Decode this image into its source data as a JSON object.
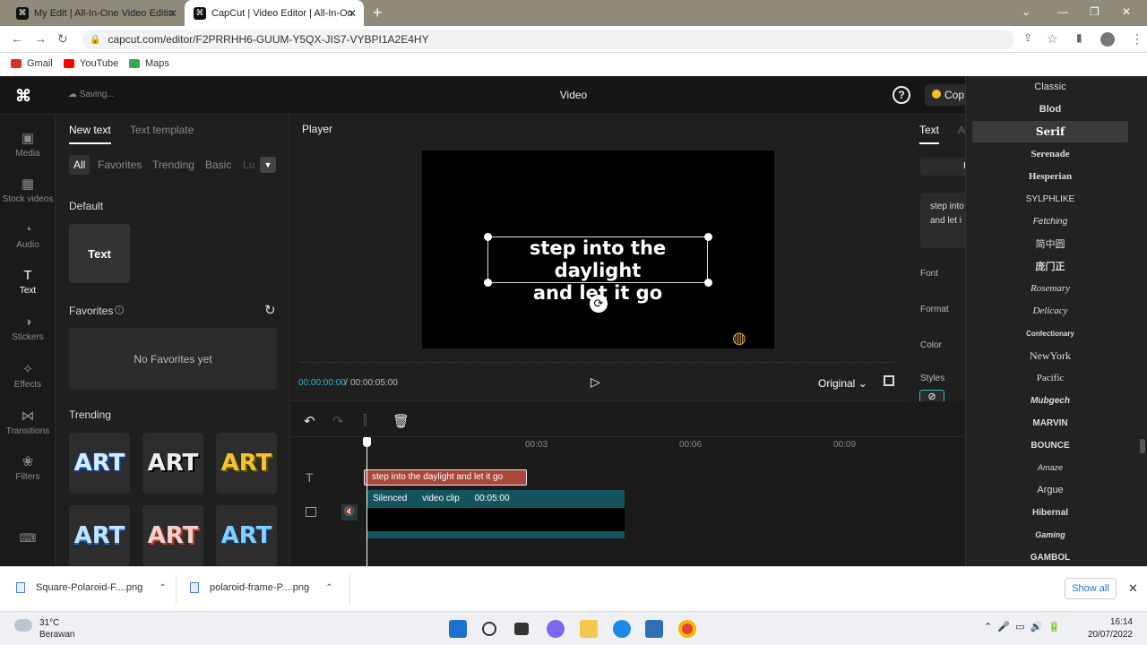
{
  "browser": {
    "tabs": [
      {
        "label": "My Edit | All-In-One Video Editin",
        "active": false
      },
      {
        "label": "CapCut | Video Editor | All-In-On",
        "active": true
      }
    ],
    "url": "capcut.com/editor/F2PRRHH6-GUUM-Y5QX-JIS7-VYBPI1A2E4HY",
    "bookmarks": [
      "Gmail",
      "YouTube",
      "Maps"
    ]
  },
  "app": {
    "status": "Saving...",
    "title": "Video",
    "copy_label": "Cop"
  },
  "rail": [
    {
      "label": "Media",
      "icon": "media-icon"
    },
    {
      "label": "Stock videos",
      "icon": "stock-videos-icon"
    },
    {
      "label": "Audio",
      "icon": "audio-icon"
    },
    {
      "label": "Text",
      "icon": "text-icon",
      "active": true
    },
    {
      "label": "Stickers",
      "icon": "stickers-icon"
    },
    {
      "label": "Effects",
      "icon": "effects-icon"
    },
    {
      "label": "Transitions",
      "icon": "transitions-icon"
    },
    {
      "label": "Filters",
      "icon": "filters-icon"
    }
  ],
  "panel": {
    "tabs": [
      "New text",
      "Text template"
    ],
    "chips": [
      "All",
      "Favorites",
      "Trending",
      "Basic",
      "Lu"
    ],
    "default_label": "Default",
    "default_card": "Text",
    "favorites_label": "Favorites",
    "no_favorites": "No Favorites yet",
    "trending_label": "Trending",
    "art_cards": [
      "ART",
      "ART",
      "ART",
      "ART",
      "ART",
      "ART"
    ]
  },
  "player": {
    "label": "Player",
    "caption_line1": "step into the daylight",
    "caption_line2": "and let it go",
    "current_time": "00:00:00:00",
    "separator": "/",
    "total_time": "00:00:05:00",
    "ratio": "Original"
  },
  "right_panel": {
    "tab_text": "Text",
    "tab_anim": "A",
    "button": "I",
    "text_line1": "step into",
    "text_line2": "and let i",
    "font_label": "Font",
    "format_label": "Format",
    "color_label": "Color",
    "styles_label": "Styles"
  },
  "timeline": {
    "ticks": [
      "00:03",
      "00:06",
      "00:09"
    ],
    "text_clip": "step into the daylight and let it go",
    "video_status": "Silenced",
    "video_name": "video clip",
    "video_duration": "00:05:00"
  },
  "font_menu": {
    "selected": "Serif",
    "items": [
      "Classic",
      "Blod",
      "Serif",
      "Serenade",
      "Hesperian",
      "SYLPHLIKE",
      "Fetching",
      "简中圆",
      "庞门正",
      "Rosemary",
      "Delicacy",
      "Confectionary",
      "NewYork",
      "Pacific",
      "Mubgech",
      "MARVIN",
      "BOUNCE",
      "Amaze",
      "Argue",
      "Hibernal",
      "Gaming",
      "GAMBOL"
    ]
  },
  "downloads": {
    "items": [
      "Square-Polaroid-F....png",
      "polaroid-frame-P....png"
    ],
    "show_all": "Show all"
  },
  "taskbar": {
    "temperature": "31°C",
    "weather": "Berawan",
    "time": "16:14",
    "date": "20/07/2022"
  },
  "colors": {
    "accent": "#2fb7c6",
    "text_clip": "#a9473a",
    "video_clip": "#14545e"
  }
}
